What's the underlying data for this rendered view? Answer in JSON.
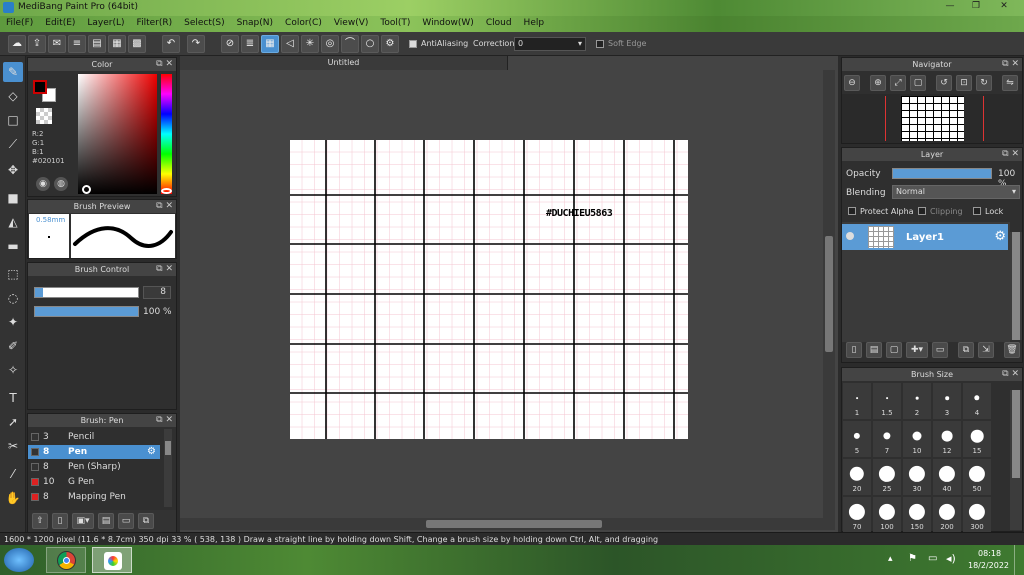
{
  "window": {
    "title": "MediBang Paint Pro (64bit)",
    "min": "—",
    "max": "❐",
    "close": "✕"
  },
  "menu": [
    "File(F)",
    "Edit(E)",
    "Layer(L)",
    "Filter(R)",
    "Select(S)",
    "Snap(N)",
    "Color(C)",
    "View(V)",
    "Tool(T)",
    "Window(W)",
    "Cloud",
    "Help"
  ],
  "toolbar": {
    "antialiasing": "AntiAliasing",
    "correction_label": "Correction",
    "correction_value": "0",
    "soft_edge": "Soft Edge"
  },
  "color_panel": {
    "title": "Color",
    "r": "R:2",
    "g": "G:1",
    "b": "B:1",
    "hex": "#020101",
    "main_color": "#020101"
  },
  "brush_preview": {
    "title": "Brush Preview",
    "size": "0.58mm"
  },
  "brush_control": {
    "title": "Brush Control",
    "size_value": "8",
    "size_fraction": 0.08,
    "opacity_value": "100 %",
    "opacity_fraction": 1.0
  },
  "brush_list": {
    "title": "Brush: Pen",
    "items": [
      {
        "size": "3",
        "name": "Pencil",
        "color": "#333333"
      },
      {
        "size": "8",
        "name": "Pen",
        "color": "#333333"
      },
      {
        "size": "8",
        "name": "Pen (Sharp)",
        "color": "#333333"
      },
      {
        "size": "10",
        "name": "G Pen",
        "color": "#dd2222"
      },
      {
        "size": "8",
        "name": "Mapping Pen",
        "color": "#dd2222"
      }
    ]
  },
  "document": {
    "tab": "Untitled",
    "watermark": "#DUCHIEU5863"
  },
  "navigator": {
    "title": "Navigator"
  },
  "layer_panel": {
    "title": "Layer",
    "opacity_label": "Opacity",
    "opacity_value": "100 %",
    "blending_label": "Blending",
    "blending_value": "Normal",
    "protect_alpha": "Protect Alpha",
    "clipping": "Clipping",
    "lock": "Lock",
    "layer_name": "Layer1"
  },
  "brush_size": {
    "title": "Brush Size",
    "sizes": [
      "1",
      "1.5",
      "2",
      "3",
      "4",
      "5",
      "7",
      "10",
      "12",
      "15",
      "20",
      "25",
      "30",
      "40",
      "50",
      "70",
      "100",
      "150",
      "200",
      "300"
    ]
  },
  "status": {
    "dims": "1600 * 1200 pixel",
    "physical": "(11.6 * 8.7cm)",
    "dpi": "350 dpi",
    "zoom": "33 %",
    "coords": "( 538, 138 )",
    "hint": "Draw a straight line by holding down Shift, Change a brush size by holding down Ctrl, Alt, and dragging"
  },
  "taskbar": {
    "time": "08:18",
    "date": "18/2/2022"
  }
}
